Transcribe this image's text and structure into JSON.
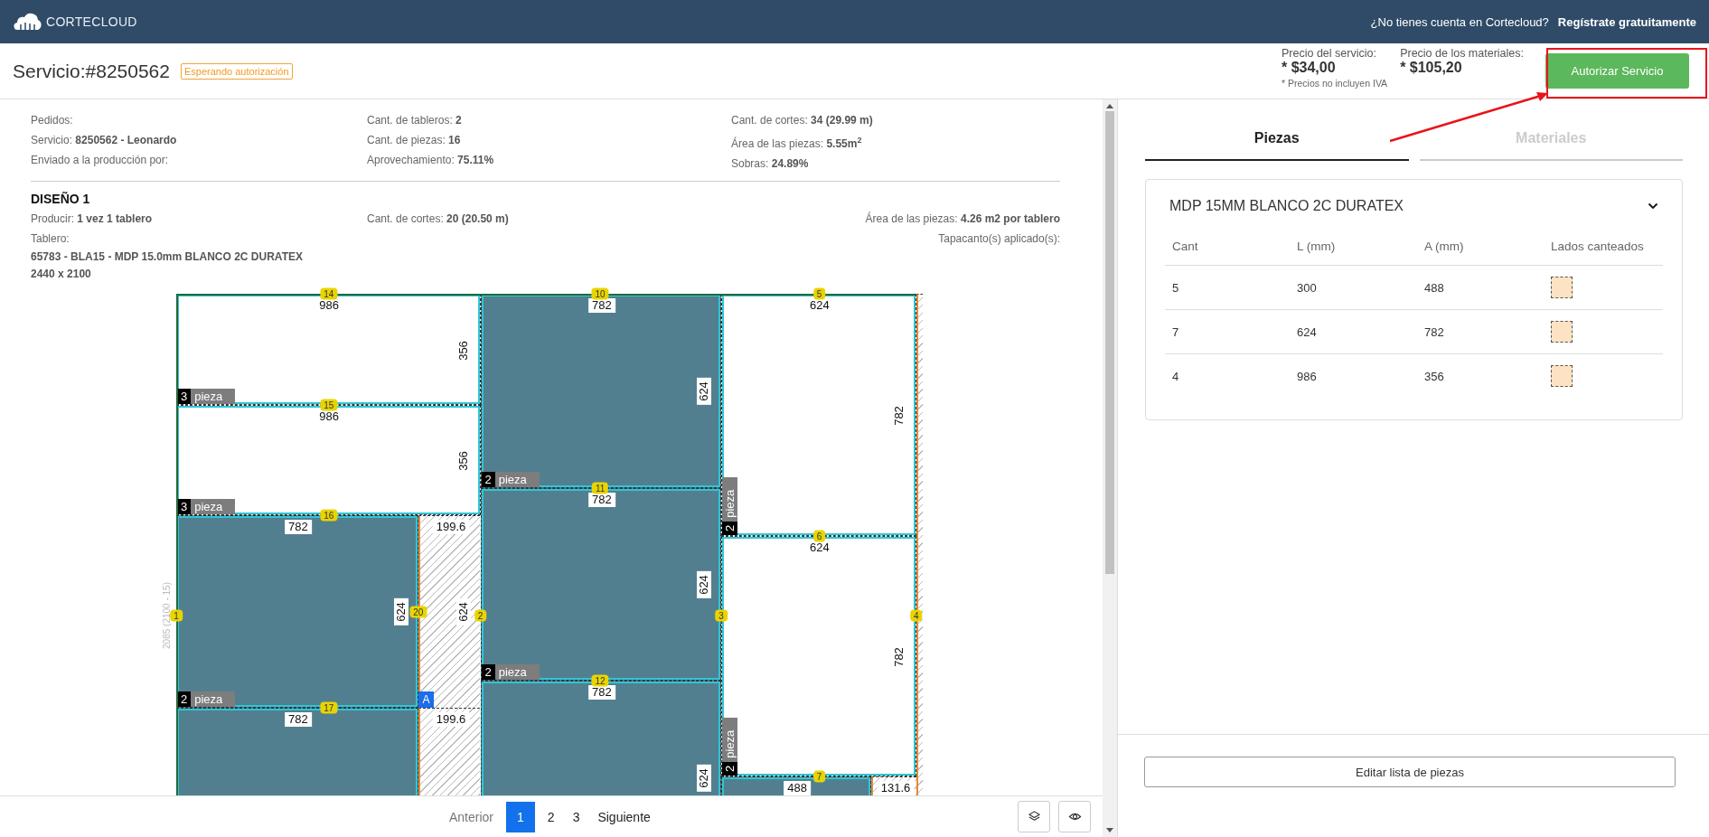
{
  "topbar": {
    "brand": "CORTECLOUD",
    "question": "¿No tienes cuenta en Cortecloud?",
    "signup": "Regístrate gratuitamente"
  },
  "header": {
    "title": "Servicio:#8250562",
    "status": "Esperando autorización",
    "prices": [
      {
        "label": "Precio del servicio:",
        "value": "* $34,00"
      },
      {
        "label": "Precio de los materiales:",
        "value": "* $105,20"
      }
    ],
    "note": "* Precios no incluyen IVA",
    "action": "Autorizar Servicio"
  },
  "summary": [
    [
      "Pedidos:",
      "Servicio: **8250562 - Leonardo**",
      "Enviado a la producción por:"
    ],
    [
      "Cant. de tableros: **2**",
      "Cant. de piezas: **16**",
      "Aprovechamiento: **75.11%**"
    ],
    [
      "Cant. de cortes: **34 (29.99 m)**",
      "Área de las piezas: **5.55m**$^{2}$",
      "Sobras: **24.89%**"
    ]
  ],
  "design": {
    "title": "DISEÑO 1",
    "produce": "Producir: **1 vez 1 tablero**",
    "cuts": "Cant. de cortes: **20 (20.50 m)**",
    "area": "Área de las piezas: **4.26 m2 por tablero**",
    "board_label": "Tablero:",
    "edging_label": "Tapacanto(s) aplicado(s):",
    "board_name": "65783 - BLA15 - MDP 15.0mm BLANCO 2C DURATEX",
    "board_size": "2440 x 2100"
  },
  "diagram": {
    "side_label": "2085 (2100 - 15)",
    "marker": "A",
    "parts": [
      {
        "kind": "piece",
        "shaded": false,
        "top_label": "986",
        "side_label": "356",
        "tag": {
          "count": "3",
          "text": "pieza",
          "rotated": false
        }
      },
      {
        "kind": "piece",
        "shaded": false,
        "top_label": "986",
        "side_label": "356",
        "tag": {
          "count": "3",
          "text": "pieza",
          "rotated": false
        }
      },
      {
        "kind": "piece",
        "shaded": true,
        "top_label": "782",
        "side_label": "624",
        "tag": {
          "count": "2",
          "text": "pieza",
          "rotated": false
        }
      },
      {
        "kind": "waste",
        "top_label": "199.6",
        "side_label": "624"
      },
      {
        "kind": "piece",
        "shaded": true,
        "top_label": "782"
      },
      {
        "kind": "waste",
        "top_label": "199.6"
      },
      {
        "kind": "piece",
        "shaded": true,
        "top_label": "782",
        "side_label": "624",
        "tag": {
          "count": "2",
          "text": "pieza",
          "rotated": false
        }
      },
      {
        "kind": "piece",
        "shaded": true,
        "top_label": "782",
        "side_label": "624",
        "tag": {
          "count": "2",
          "text": "pieza",
          "rotated": false
        }
      },
      {
        "kind": "piece",
        "shaded": true,
        "top_label": "782",
        "side_label": "624"
      },
      {
        "kind": "piece",
        "shaded": false,
        "top_label": "624",
        "side_label": "782",
        "tag": {
          "count": "2",
          "text": "pieza",
          "rotated": true
        }
      },
      {
        "kind": "piece",
        "shaded": false,
        "top_label": "624",
        "side_label": "782",
        "tag": {
          "count": "2",
          "text": "pieza",
          "rotated": true
        }
      },
      {
        "kind": "piece",
        "shaded": true,
        "top_label": "488"
      },
      {
        "kind": "waste",
        "top_label": "131.6"
      },
      {
        "kind": "waste"
      }
    ],
    "cuts": [
      "14",
      "15",
      "16",
      "17",
      "10",
      "11",
      "12",
      "5",
      "6",
      "7",
      "1",
      "20",
      "2",
      "3",
      "4"
    ]
  },
  "pagination": {
    "previous": {
      "label": "Anterior",
      "disabled": true
    },
    "pages": [
      {
        "label": "1",
        "selected": true
      },
      {
        "label": "2",
        "selected": false
      },
      {
        "label": "3",
        "selected": false
      }
    ],
    "next": {
      "label": "Siguiente",
      "disabled": false
    }
  },
  "tabs": [
    {
      "label": "Piezas",
      "selected": true
    },
    {
      "label": "Materiales",
      "selected": false
    }
  ],
  "material": {
    "title": "MDP 15MM BLANCO 2C DURATEX",
    "expanded": true,
    "columns": [
      "Cant",
      "L (mm)",
      "A (mm)",
      "Lados canteados"
    ],
    "rows": [
      [
        "5",
        "300",
        "488"
      ],
      [
        "7",
        "624",
        "782"
      ],
      [
        "4",
        "986",
        "356"
      ]
    ]
  },
  "edit_button": "Editar lista de piezas"
}
